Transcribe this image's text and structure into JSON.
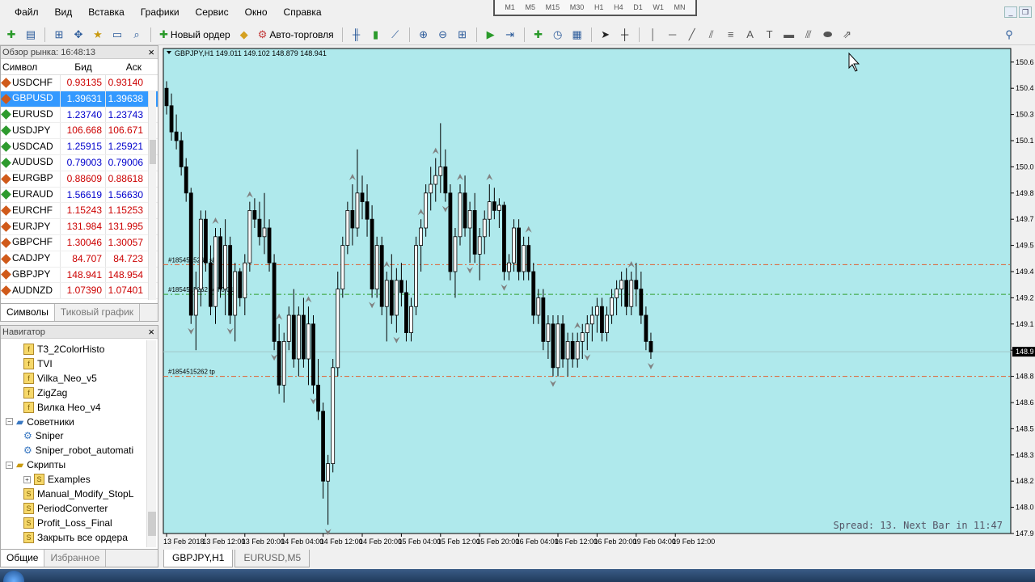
{
  "menu": [
    "Файл",
    "Вид",
    "Вставка",
    "Графики",
    "Сервис",
    "Окно",
    "Справка"
  ],
  "timeframes": [
    "M1",
    "M5",
    "M15",
    "M30",
    "H1",
    "H4",
    "D1",
    "W1",
    "MN"
  ],
  "toolbar": {
    "new_order_label": "Новый ордер",
    "auto_trading_label": "Авто-торговля"
  },
  "market_watch": {
    "title": "Обзор рынка: 16:48:13",
    "columns": [
      "Символ",
      "Бид",
      "Аск"
    ],
    "rows": [
      {
        "symbol": "USDCHF",
        "bid": "0.93135",
        "ask": "0.93140",
        "color": "#cc0000",
        "dir": "#d05a1a"
      },
      {
        "symbol": "GBPUSD",
        "bid": "1.39631",
        "ask": "1.39638",
        "color": "#ffffff",
        "dir": "#d05a1a"
      },
      {
        "symbol": "EURUSD",
        "bid": "1.23740",
        "ask": "1.23743",
        "color": "#0000cc",
        "dir": "#2e9a2e"
      },
      {
        "symbol": "USDJPY",
        "bid": "106.668",
        "ask": "106.671",
        "color": "#cc0000",
        "dir": "#2e9a2e"
      },
      {
        "symbol": "USDCAD",
        "bid": "1.25915",
        "ask": "1.25921",
        "color": "#0000cc",
        "dir": "#2e9a2e"
      },
      {
        "symbol": "AUDUSD",
        "bid": "0.79003",
        "ask": "0.79006",
        "color": "#0000cc",
        "dir": "#2e9a2e"
      },
      {
        "symbol": "EURGBP",
        "bid": "0.88609",
        "ask": "0.88618",
        "color": "#cc0000",
        "dir": "#d05a1a"
      },
      {
        "symbol": "EURAUD",
        "bid": "1.56619",
        "ask": "1.56630",
        "color": "#0000cc",
        "dir": "#2e9a2e"
      },
      {
        "symbol": "EURCHF",
        "bid": "1.15243",
        "ask": "1.15253",
        "color": "#cc0000",
        "dir": "#d05a1a"
      },
      {
        "symbol": "EURJPY",
        "bid": "131.984",
        "ask": "131.995",
        "color": "#cc0000",
        "dir": "#d05a1a"
      },
      {
        "symbol": "GBPCHF",
        "bid": "1.30046",
        "ask": "1.30057",
        "color": "#cc0000",
        "dir": "#d05a1a"
      },
      {
        "symbol": "CADJPY",
        "bid": "84.707",
        "ask": "84.723",
        "color": "#cc0000",
        "dir": "#d05a1a"
      },
      {
        "symbol": "GBPJPY",
        "bid": "148.941",
        "ask": "148.954",
        "color": "#cc0000",
        "dir": "#d05a1a"
      },
      {
        "symbol": "AUDNZD",
        "bid": "1.07390",
        "ask": "1.07401",
        "color": "#cc0000",
        "dir": "#d05a1a"
      }
    ],
    "tabs": [
      "Символы",
      "Тиковый график"
    ]
  },
  "navigator": {
    "title": "Навигатор",
    "items": [
      {
        "label": "T3_2ColorHisto",
        "kind": "indicator",
        "level": 2
      },
      {
        "label": "TVI",
        "kind": "indicator",
        "level": 2
      },
      {
        "label": "Vilka_Neo_v5",
        "kind": "indicator",
        "level": 2
      },
      {
        "label": "ZigZag",
        "kind": "indicator",
        "level": 2
      },
      {
        "label": "Вилка Нео_v4",
        "kind": "indicator",
        "level": 2
      },
      {
        "label": "Советники",
        "kind": "folder",
        "level": 1,
        "toggle": "−"
      },
      {
        "label": "Sniper",
        "kind": "ea",
        "level": 2
      },
      {
        "label": "Sniper_robot_automati",
        "kind": "ea",
        "level": 2
      },
      {
        "label": "Скрипты",
        "kind": "folder",
        "level": 1,
        "toggle": "−"
      },
      {
        "label": "Examples",
        "kind": "script-folder",
        "level": 2,
        "toggle": "+"
      },
      {
        "label": "Manual_Modify_StopL",
        "kind": "script",
        "level": 2
      },
      {
        "label": "PeriodConverter",
        "kind": "script",
        "level": 2
      },
      {
        "label": "Profit_Loss_Final",
        "kind": "script",
        "level": 2
      },
      {
        "label": "Закрыть все ордера",
        "kind": "script",
        "level": 2
      }
    ],
    "tabs": [
      "Общие",
      "Избранное"
    ]
  },
  "chart_tabs": [
    "GBPJPY,H1",
    "EURUSD,M5"
  ],
  "chart_data": {
    "type": "candlestick",
    "header": "GBPJPY,H1  149.011 149.102 148.879 148.941",
    "background": "#afe9ec",
    "ylim": [
      147.9,
      150.65
    ],
    "y_ticks": [
      "150.6",
      "150.4",
      "150.3",
      "150.1",
      "150.0",
      "149.8",
      "149.7",
      "149.5",
      "149.4",
      "149.2",
      "149.1",
      "148.9",
      "148.8",
      "148.6",
      "148.5",
      "148.3",
      "148.2",
      "148.0",
      "147.9"
    ],
    "y_tick_values": [
      150.6,
      150.45,
      150.3,
      150.15,
      150.0,
      149.85,
      149.7,
      149.55,
      149.4,
      149.25,
      149.1,
      148.95,
      148.8,
      148.65,
      148.5,
      148.35,
      148.2,
      148.05,
      147.9
    ],
    "current_price_label": "148.9",
    "current_price": 148.941,
    "x_labels": [
      "13 Feb 2018",
      "13 Feb 12:00",
      "13 Feb 20:00",
      "14 Feb 04:00",
      "14 Feb 12:00",
      "14 Feb 20:00",
      "15 Feb 04:00",
      "15 Feb 12:00",
      "15 Feb 20:00",
      "16 Feb 04:00",
      "16 Feb 12:00",
      "16 Feb 20:00",
      "19 Feb 04:00",
      "19 Feb 12:00"
    ],
    "x_label_bar_index": [
      0,
      8,
      16,
      24,
      32,
      40,
      48,
      56,
      64,
      72,
      80,
      88,
      96,
      104
    ],
    "lines": [
      {
        "label": "#1854515262 sl",
        "price": 149.44,
        "color": "#e06030"
      },
      {
        "label": "#1854515262 sell 0.01",
        "price": 149.27,
        "color": "#30a030"
      },
      {
        "label": "#1854515262 tp",
        "price": 148.8,
        "color": "#e06030"
      }
    ],
    "footer_text": "Spread: 13. Next Bar in 11:47",
    "candles": [
      [
        150.45,
        150.49,
        150.3,
        150.35
      ],
      [
        150.35,
        150.42,
        150.15,
        150.2
      ],
      [
        150.2,
        150.3,
        150.1,
        150.15
      ],
      [
        150.15,
        150.2,
        149.95,
        150.0
      ],
      [
        150.0,
        150.05,
        149.8,
        149.85
      ],
      [
        149.85,
        149.88,
        149.1,
        149.15
      ],
      [
        149.15,
        149.4,
        148.95,
        149.3
      ],
      [
        149.3,
        149.75,
        149.2,
        149.7
      ],
      [
        149.7,
        149.75,
        149.4,
        149.45
      ],
      [
        149.45,
        149.55,
        149.15,
        149.2
      ],
      [
        149.2,
        149.65,
        149.1,
        149.6
      ],
      [
        149.6,
        149.65,
        149.25,
        149.3
      ],
      [
        149.3,
        149.7,
        149.15,
        149.55
      ],
      [
        149.55,
        149.6,
        149.1,
        149.15
      ],
      [
        149.15,
        149.45,
        149.0,
        149.4
      ],
      [
        149.4,
        149.42,
        149.2,
        149.25
      ],
      [
        149.25,
        149.5,
        149.15,
        149.45
      ],
      [
        149.45,
        149.8,
        149.4,
        149.75
      ],
      [
        149.75,
        149.82,
        149.65,
        149.7
      ],
      [
        149.7,
        149.8,
        149.55,
        149.6
      ],
      [
        149.6,
        149.85,
        149.5,
        149.65
      ],
      [
        149.65,
        149.7,
        149.4,
        149.45
      ],
      [
        149.45,
        149.5,
        148.95,
        149.0
      ],
      [
        149.0,
        149.1,
        148.7,
        148.75
      ],
      [
        148.75,
        149.05,
        148.65,
        149.0
      ],
      [
        149.0,
        149.2,
        148.95,
        149.15
      ],
      [
        149.15,
        149.3,
        148.85,
        148.9
      ],
      [
        148.9,
        149.2,
        148.8,
        149.15
      ],
      [
        149.15,
        149.25,
        148.85,
        148.9
      ],
      [
        148.9,
        149.2,
        148.75,
        149.1
      ],
      [
        149.1,
        149.15,
        148.7,
        148.75
      ],
      [
        148.75,
        148.9,
        148.55,
        148.6
      ],
      [
        148.6,
        148.65,
        148.1,
        148.2
      ],
      [
        148.2,
        148.35,
        147.95,
        148.3
      ],
      [
        148.3,
        148.9,
        148.25,
        148.85
      ],
      [
        148.85,
        149.4,
        148.8,
        149.3
      ],
      [
        149.3,
        149.6,
        149.25,
        149.55
      ],
      [
        149.55,
        149.8,
        149.5,
        149.75
      ],
      [
        149.75,
        149.9,
        149.55,
        149.65
      ],
      [
        149.65,
        150.1,
        149.6,
        149.85
      ],
      [
        149.85,
        149.95,
        149.7,
        149.8
      ],
      [
        149.8,
        149.9,
        149.6,
        149.7
      ],
      [
        149.7,
        149.78,
        149.25,
        149.3
      ],
      [
        149.3,
        149.6,
        149.25,
        149.55
      ],
      [
        149.55,
        149.6,
        149.15,
        149.2
      ],
      [
        149.2,
        149.4,
        149.0,
        149.35
      ],
      [
        149.35,
        149.5,
        149.1,
        149.15
      ],
      [
        149.15,
        149.42,
        149.05,
        149.35
      ],
      [
        149.35,
        149.45,
        149.2,
        149.28
      ],
      [
        149.28,
        149.35,
        149.0,
        149.05
      ],
      [
        149.05,
        149.25,
        149.0,
        149.2
      ],
      [
        149.2,
        149.6,
        149.15,
        149.55
      ],
      [
        149.55,
        149.7,
        149.4,
        149.65
      ],
      [
        149.65,
        149.9,
        149.6,
        149.85
      ],
      [
        149.85,
        150.0,
        149.75,
        149.9
      ],
      [
        149.9,
        150.05,
        149.8,
        149.95
      ],
      [
        149.95,
        150.25,
        149.85,
        150.0
      ],
      [
        150.0,
        150.1,
        149.8,
        149.85
      ],
      [
        149.85,
        149.9,
        149.35,
        149.4
      ],
      [
        149.4,
        149.65,
        149.25,
        149.6
      ],
      [
        149.6,
        149.9,
        149.55,
        149.85
      ],
      [
        149.85,
        149.95,
        149.6,
        149.65
      ],
      [
        149.65,
        149.8,
        149.45,
        149.75
      ],
      [
        149.75,
        149.85,
        149.45,
        149.5
      ],
      [
        149.5,
        149.65,
        149.35,
        149.6
      ],
      [
        149.6,
        149.75,
        149.5,
        149.7
      ],
      [
        149.7,
        149.9,
        149.6,
        149.8
      ],
      [
        149.8,
        149.88,
        149.7,
        149.75
      ],
      [
        149.75,
        149.82,
        149.65,
        149.78
      ],
      [
        149.78,
        149.8,
        149.35,
        149.4
      ],
      [
        149.4,
        149.5,
        149.35,
        149.45
      ],
      [
        149.45,
        149.7,
        149.4,
        149.65
      ],
      [
        149.65,
        149.7,
        149.35,
        149.4
      ],
      [
        149.4,
        149.6,
        149.35,
        149.55
      ],
      [
        149.55,
        149.6,
        149.35,
        149.4
      ],
      [
        149.4,
        149.45,
        149.1,
        149.15
      ],
      [
        149.15,
        149.3,
        149.1,
        149.25
      ],
      [
        149.25,
        149.3,
        148.95,
        149.0
      ],
      [
        149.0,
        149.15,
        148.9,
        149.1
      ],
      [
        149.1,
        149.15,
        148.8,
        148.85
      ],
      [
        148.85,
        149.15,
        148.8,
        149.1
      ],
      [
        149.1,
        149.15,
        148.85,
        148.9
      ],
      [
        148.9,
        149.05,
        148.8,
        149.0
      ],
      [
        149.0,
        149.05,
        148.85,
        148.9
      ],
      [
        148.9,
        149.05,
        148.85,
        149.0
      ],
      [
        149.0,
        149.1,
        148.9,
        149.05
      ],
      [
        149.05,
        149.15,
        148.95,
        149.1
      ],
      [
        149.1,
        149.2,
        149.0,
        149.15
      ],
      [
        149.15,
        149.25,
        149.05,
        149.2
      ],
      [
        149.2,
        149.25,
        149.0,
        149.05
      ],
      [
        149.05,
        149.2,
        149.0,
        149.15
      ],
      [
        149.15,
        149.3,
        149.1,
        149.25
      ],
      [
        149.25,
        149.35,
        149.15,
        149.3
      ],
      [
        149.3,
        149.4,
        149.2,
        149.35
      ],
      [
        149.35,
        149.42,
        149.15,
        149.2
      ],
      [
        149.2,
        149.4,
        149.15,
        149.35
      ],
      [
        149.35,
        149.45,
        149.2,
        149.3
      ],
      [
        149.3,
        149.4,
        149.1,
        149.15
      ],
      [
        149.15,
        149.2,
        148.95,
        149.0
      ],
      [
        149.0,
        149.05,
        148.9,
        148.94
      ]
    ],
    "fractals_up": [
      10,
      17,
      23,
      29,
      38,
      45,
      52,
      55,
      60,
      66,
      74,
      84,
      95
    ],
    "fractals_down": [
      5,
      13,
      22,
      30,
      33,
      42,
      47,
      57,
      62,
      69,
      79,
      86,
      99
    ]
  }
}
